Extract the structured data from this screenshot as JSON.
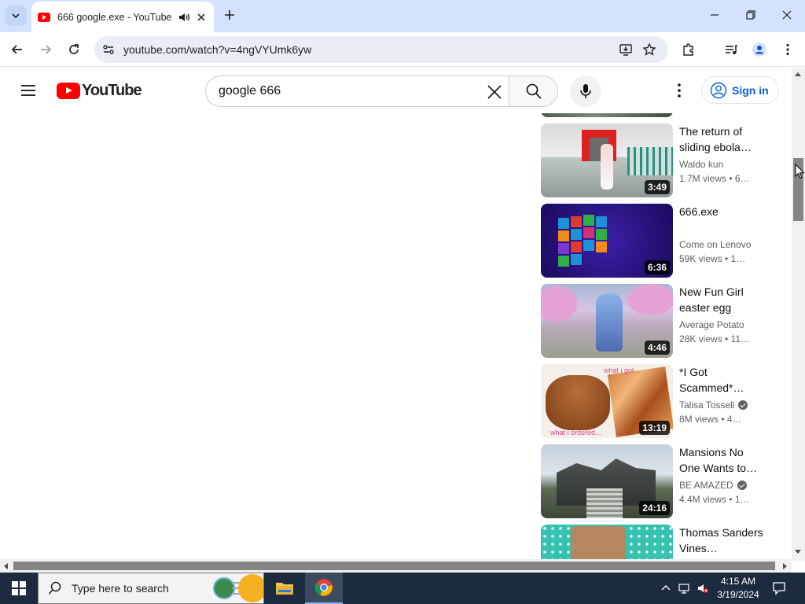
{
  "browser": {
    "tab": {
      "title": "666 google.exe - YouTube"
    },
    "url": "youtube.com/watch?v=4ngVYUmk6yw"
  },
  "header": {
    "logo_text": "YouTube",
    "search_value": "google 666",
    "sign_in": "Sign in"
  },
  "videos": [
    {
      "title": "The return of sliding ebola…",
      "channel": "Waldo kun",
      "verified": false,
      "meta": "1.7M views  • 6…",
      "duration": "3:49"
    },
    {
      "title": "666.exe",
      "channel": "Come on Lenovo",
      "verified": false,
      "meta": "59K views  • 1…",
      "duration": "6:36"
    },
    {
      "title": "New Fun Girl easter egg",
      "channel": "Average Potato",
      "verified": false,
      "meta": "28K views  • 11…",
      "duration": "4:46"
    },
    {
      "title": "*I Got Scammed*…",
      "channel": "Talisa Tossell",
      "verified": true,
      "meta": "8M views  • 4…",
      "duration": "13:19"
    },
    {
      "title": "Mansions No One Wants to…",
      "channel": "BE AMAZED",
      "verified": true,
      "meta": "4.4M views  • 1…",
      "duration": "24:16"
    },
    {
      "title": "Thomas Sanders Vines…",
      "channel": "",
      "verified": false,
      "meta": "",
      "duration": ""
    }
  ],
  "thumb_text": {
    "scam_top": "what i got...",
    "scam_bottom": "what i ordered..."
  },
  "taskbar": {
    "search_placeholder": "Type here to search",
    "time": "4:15 AM",
    "date": "3/19/2024"
  },
  "colors": {
    "tabstrip": "#d3e3fd",
    "youtube_red": "#ff0000",
    "link_blue": "#065fd4",
    "taskbar": "#1c2b3f"
  }
}
